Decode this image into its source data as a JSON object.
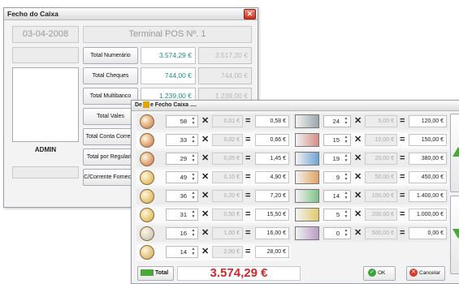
{
  "main_window": {
    "title": "Fecho do Caixa",
    "date": "03-04-2008",
    "terminal": "Terminal POS Nº. 1",
    "user": "ADMIN",
    "rows": [
      {
        "label": "Total Numerário",
        "value": "3.574,29 €",
        "value2": "3.517,20 €"
      },
      {
        "label": "Total Cheques",
        "value": "744,00 €",
        "value2": "744,00 €"
      },
      {
        "label": "Total Multibanco",
        "value": "1.239,00 €",
        "value2": "1.239,00 €"
      },
      {
        "label": "Total Vales",
        "value": "",
        "value2": ""
      },
      {
        "label": "Total Conta Corrent",
        "value": "",
        "value2": ""
      },
      {
        "label": "Total por Regulariz",
        "value": "",
        "value2": ""
      },
      {
        "label": "C/Corrente Forneced",
        "value": "",
        "value2": ""
      }
    ]
  },
  "popup": {
    "title_prefix": "De",
    "title_rest": "e Fecho Caixa ....",
    "coins": [
      {
        "count": "58",
        "unit": "0,01 €",
        "total": "0,58 €"
      },
      {
        "count": "33",
        "unit": "0,02 €",
        "total": "0,66 €"
      },
      {
        "count": "29",
        "unit": "0,05 €",
        "total": "1,45 €"
      },
      {
        "count": "49",
        "unit": "0,10 €",
        "total": "4,90 €"
      },
      {
        "count": "36",
        "unit": "0,20 €",
        "total": "7,20 €"
      },
      {
        "count": "31",
        "unit": "0,50 €",
        "total": "15,50 €"
      },
      {
        "count": "16",
        "unit": "1,00 €",
        "total": "16,00 €"
      },
      {
        "count": "14",
        "unit": "2,00 €",
        "total": "28,00 €"
      }
    ],
    "notes": [
      {
        "count": "24",
        "unit": "5,00 €",
        "total": "120,00 €"
      },
      {
        "count": "15",
        "unit": "10,00 €",
        "total": "150,00 €"
      },
      {
        "count": "19",
        "unit": "20,00 €",
        "total": "380,00 €"
      },
      {
        "count": "9",
        "unit": "50,00 €",
        "total": "450,00 €"
      },
      {
        "count": "14",
        "unit": "100,00 €",
        "total": "1.400,00 €"
      },
      {
        "count": "5",
        "unit": "200,00 €",
        "total": "1.000,00 €"
      },
      {
        "count": "0",
        "unit": "500,00 €",
        "total": "0,00 €"
      }
    ],
    "total_label": "Total",
    "grand_total": "3.574,29 €",
    "ok_label": "OK",
    "cancel_label": "Cancelar"
  },
  "colors": {
    "accent_green": "#23917a",
    "grand_total": "#d7262b"
  }
}
